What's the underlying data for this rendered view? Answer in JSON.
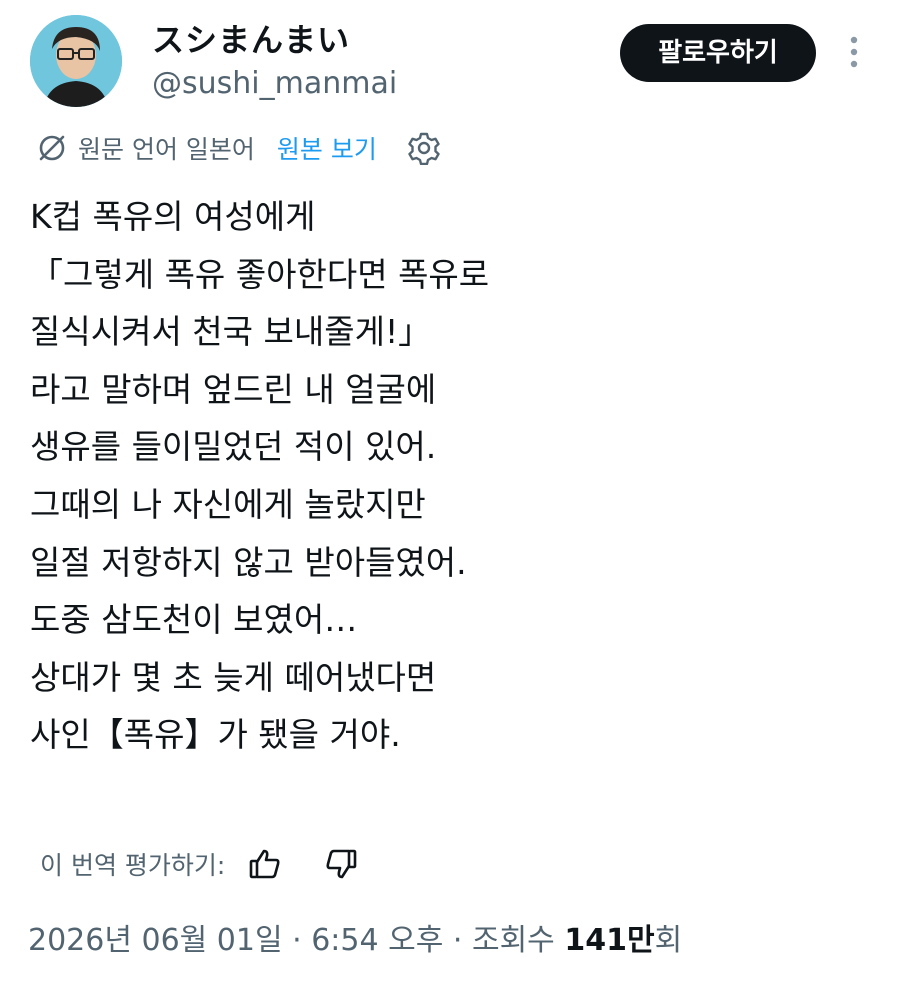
{
  "profile": {
    "display_name": "スシまんまい",
    "handle": "@sushi_manmai"
  },
  "follow_button": {
    "label": "팔로우하기"
  },
  "translation": {
    "source_language_text": "원문 언어 일본어",
    "show_original_label": "원본 보기"
  },
  "tweet": {
    "lines": [
      "K컵 폭유의 여성에게",
      "「그렇게 폭유 좋아한다면 폭유로",
      "질식시켜서 천국 보내줄게!」",
      "라고 말하며 엎드린 내 얼굴에",
      "생유를 들이밀었던 적이 있어.",
      "그때의 나 자신에게 놀랐지만",
      "일절 저항하지 않고 받아들였어.",
      "도중 삼도천이 보였어…",
      "상대가 몇 초 늦게 떼어냈다면",
      "사인【폭유】가 됐을 거야."
    ]
  },
  "rate_translation": {
    "label": "이 번역 평가하기:"
  },
  "meta": {
    "date": "2026년 06월 01일",
    "separator": "·",
    "time": "6:54 오후",
    "views_label": "조회수",
    "views_count": "141만",
    "views_suffix": "회"
  },
  "colors": {
    "text_primary": "#0f1419",
    "text_secondary": "#536471",
    "link_blue": "#1d9bf0",
    "follow_button_bg": "#0f1419",
    "avatar_bg": "#6fc6dd"
  }
}
